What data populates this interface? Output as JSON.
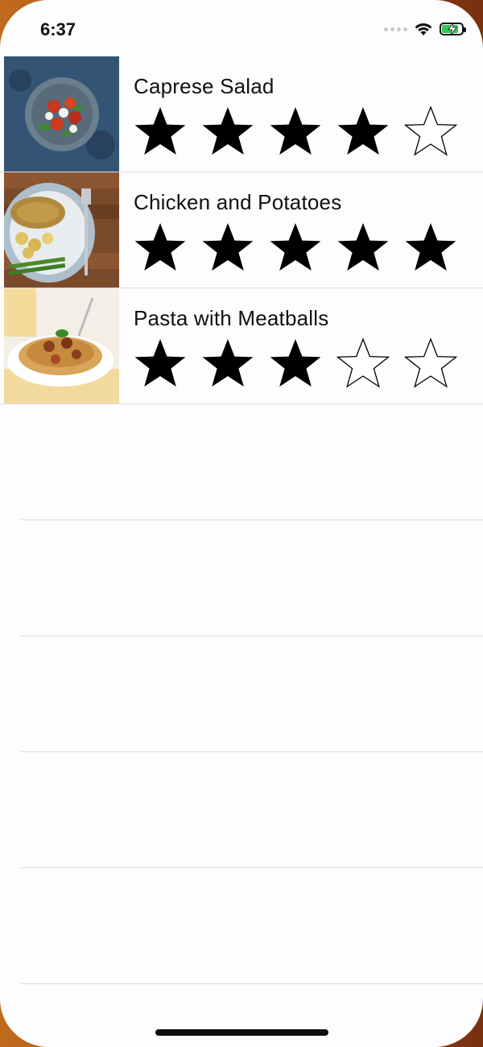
{
  "status_bar": {
    "time": "6:37",
    "battery_level": 0.85,
    "battery_color": "#34c759"
  },
  "meals": [
    {
      "name": "Caprese Salad",
      "rating": 4,
      "max_rating": 5,
      "photo_icon": "caprese-salad-photo"
    },
    {
      "name": "Chicken and Potatoes",
      "rating": 5,
      "max_rating": 5,
      "photo_icon": "chicken-potatoes-photo"
    },
    {
      "name": "Pasta with Meatballs",
      "rating": 3,
      "max_rating": 5,
      "photo_icon": "pasta-meatballs-photo"
    }
  ],
  "empty_rows": 5,
  "icons": {
    "filled_star": "filled-star-icon",
    "empty_star": "empty-star-icon"
  }
}
